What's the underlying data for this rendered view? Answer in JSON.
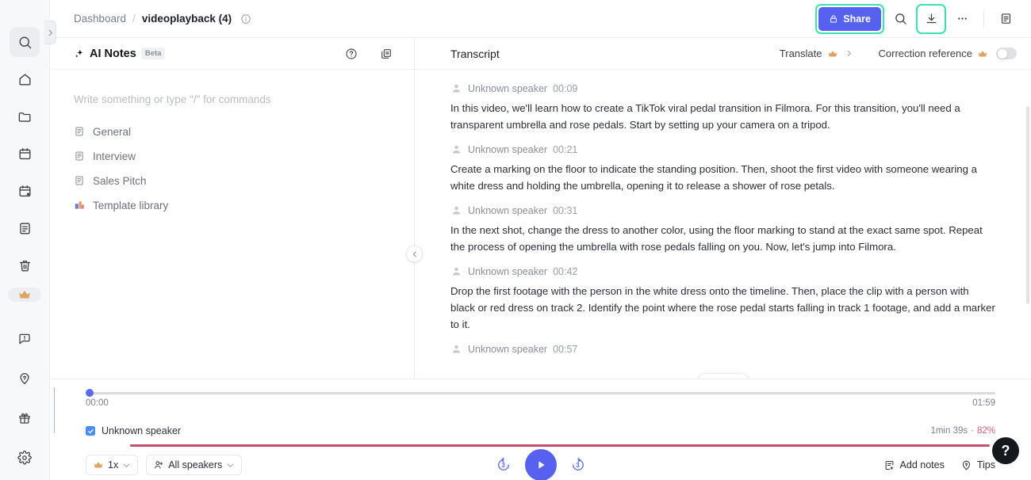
{
  "rail": {
    "logo_name": "app-logo-placeholder",
    "expand_label": "›",
    "items": [
      {
        "name": "search",
        "icon": "search-icon",
        "active": true
      },
      {
        "name": "home",
        "icon": "home-icon",
        "active": false
      },
      {
        "name": "folder",
        "icon": "folder-icon",
        "active": false
      },
      {
        "name": "calendar",
        "icon": "calendar-icon",
        "active": false
      },
      {
        "name": "schedule",
        "icon": "calendar-check-icon",
        "active": false
      },
      {
        "name": "notes",
        "icon": "note-icon",
        "active": false
      },
      {
        "name": "trash",
        "icon": "trash-icon",
        "active": false
      }
    ],
    "premium_icon": "crown-icon",
    "bottom_items": [
      {
        "name": "feedback",
        "icon": "feedback-icon"
      },
      {
        "name": "whats-new",
        "icon": "lightbulb-pin-icon"
      },
      {
        "name": "gift",
        "icon": "gift-icon"
      },
      {
        "name": "settings",
        "icon": "gear-icon"
      }
    ]
  },
  "topbar": {
    "breadcrumb_root": "Dashboard",
    "breadcrumb_sep": "/",
    "breadcrumb_current": "videoplayback (4)",
    "info_icon": "info-circle-icon",
    "share_label": "Share",
    "share_icon": "lock-icon",
    "share_bg": "#5661f0",
    "highlight_color": "#3ee0b6",
    "search_icon": "search-icon",
    "download_icon": "download-icon",
    "more_icon": "ellipsis-icon",
    "panel_icon": "document-panel-icon"
  },
  "notes": {
    "title": "AI Notes",
    "badge": "Beta",
    "sparkle_icon": "sparkle-icon",
    "help_icon": "help-circle-icon",
    "copy_icon": "duplicate-icon",
    "placeholder": "Write something or type \"/\" for commands",
    "templates": [
      {
        "label": "General",
        "icon": "document-icon"
      },
      {
        "label": "Interview",
        "icon": "document-icon"
      },
      {
        "label": "Sales Pitch",
        "icon": "document-icon"
      },
      {
        "label": "Template library",
        "icon": "template-library-icon"
      }
    ],
    "collapse_icon": "chevron-left-icon"
  },
  "transcript": {
    "title": "Transcript",
    "translate_label": "Translate",
    "translate_crown": "crown-icon",
    "translate_chevron": "chevron-right-icon",
    "correction_label": "Correction reference",
    "correction_crown": "crown-icon",
    "correction_toggle_on": false,
    "scroll_down_icon": "chevron-down-icon",
    "segments": [
      {
        "speaker": "Unknown speaker",
        "time": "00:09",
        "text": "In this video, we'll learn how to create a TikTok viral pedal transition in Filmora. For this transition, you'll need a transparent umbrella and rose pedals. Start by setting up your camera on a tripod."
      },
      {
        "speaker": "Unknown speaker",
        "time": "00:21",
        "text": "Create a marking on the floor to indicate the standing position. Then, shoot the first video with someone wearing a white dress and holding the umbrella, opening it to release a shower of rose petals."
      },
      {
        "speaker": "Unknown speaker",
        "time": "00:31",
        "text": "In the next shot, change the dress to another color, using the floor marking to stand at the exact same spot. Repeat the process of opening the umbrella with rose pedals falling on you. Now, let's jump into Filmora."
      },
      {
        "speaker": "Unknown speaker",
        "time": "00:42",
        "text": "Drop the first footage with the person in the white dress onto the timeline. Then, place the clip with a person with black or red dress on track 2. Identify the point where the rose pedal starts falling in track 1 footage, and add a marker to it."
      },
      {
        "speaker": "Unknown speaker",
        "time": "00:57",
        "text": ""
      }
    ]
  },
  "player": {
    "current_time": "00:00",
    "total_time": "01:59",
    "progress_percent": 0,
    "speaker_track": {
      "label": "Unknown speaker",
      "checked": true,
      "duration": "1min 39s",
      "separator": "·",
      "percent": "82%",
      "percent_color": "#e05a7a",
      "wave_color": "#c4506f"
    },
    "speed_label": "1x",
    "speed_crown": "crown-icon",
    "speakers_label": "All speakers",
    "speakers_icon": "people-icon",
    "rewind_label": "3",
    "forward_label": "3",
    "play_icon": "play-icon",
    "play_bg": "#5661f0",
    "add_notes_label": "Add notes",
    "add_notes_icon": "note-add-icon",
    "tips_label": "Tips",
    "tips_icon": "lightbulb-icon",
    "help_fab_label": "?"
  }
}
